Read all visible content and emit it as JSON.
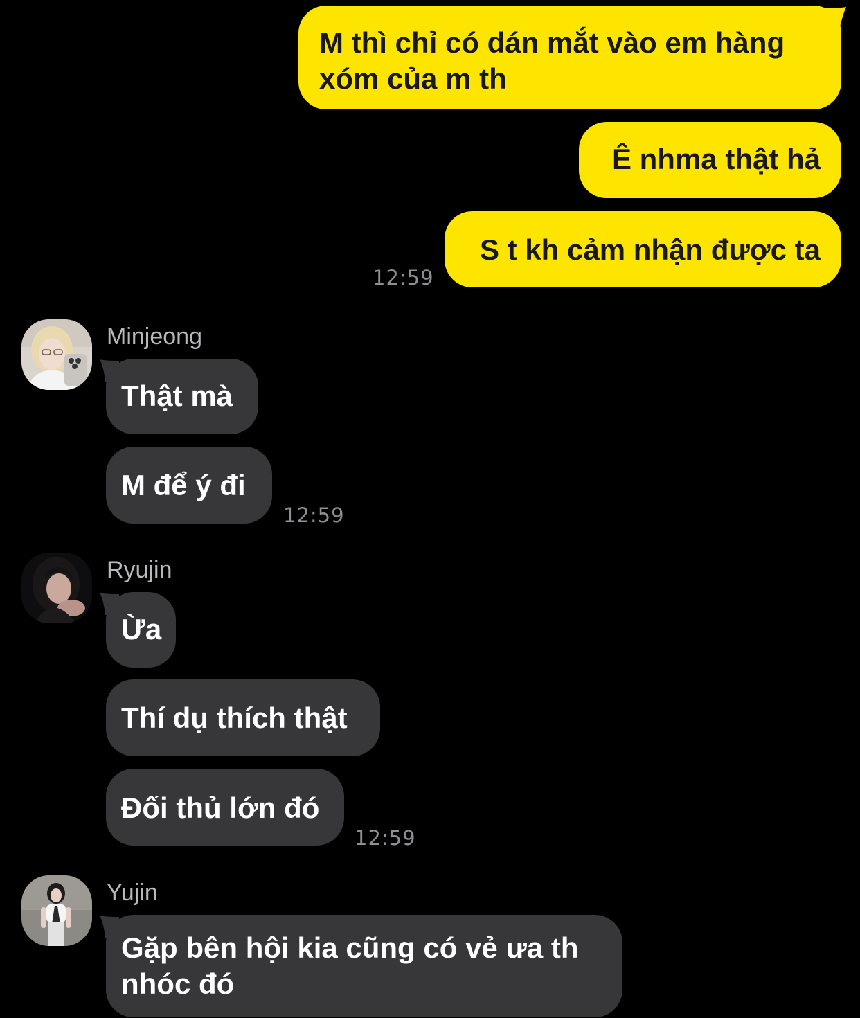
{
  "outgoing": [
    {
      "text": "M thì chỉ có dán mắt vào em hàng xóm của m th"
    },
    {
      "text": "Ê nhma thật hả"
    },
    {
      "text": "S t kh cảm nhận được ta"
    }
  ],
  "outgoing_time": "12:59",
  "groups": [
    {
      "sender": "Minjeong",
      "avatar_icon": "avatar-photo-blonde",
      "messages": [
        "Thật mà",
        "M để ý đi"
      ],
      "time": "12:59"
    },
    {
      "sender": "Ryujin",
      "avatar_icon": "avatar-photo-dark-hair",
      "messages": [
        "Ừa",
        "Thí dụ thích thật",
        "Đối thủ lớn đó"
      ],
      "time": "12:59"
    },
    {
      "sender": "Yujin",
      "avatar_icon": "avatar-photo-standing",
      "messages": [
        "Gặp bên hội kia cũng có vẻ ưa th nhóc đó"
      ]
    }
  ],
  "colors": {
    "background": "#000000",
    "outgoing_bubble": "#FEE500",
    "incoming_bubble": "#37373A",
    "timestamp": "#8E8E93",
    "sender_name": "#B8B8BD"
  }
}
